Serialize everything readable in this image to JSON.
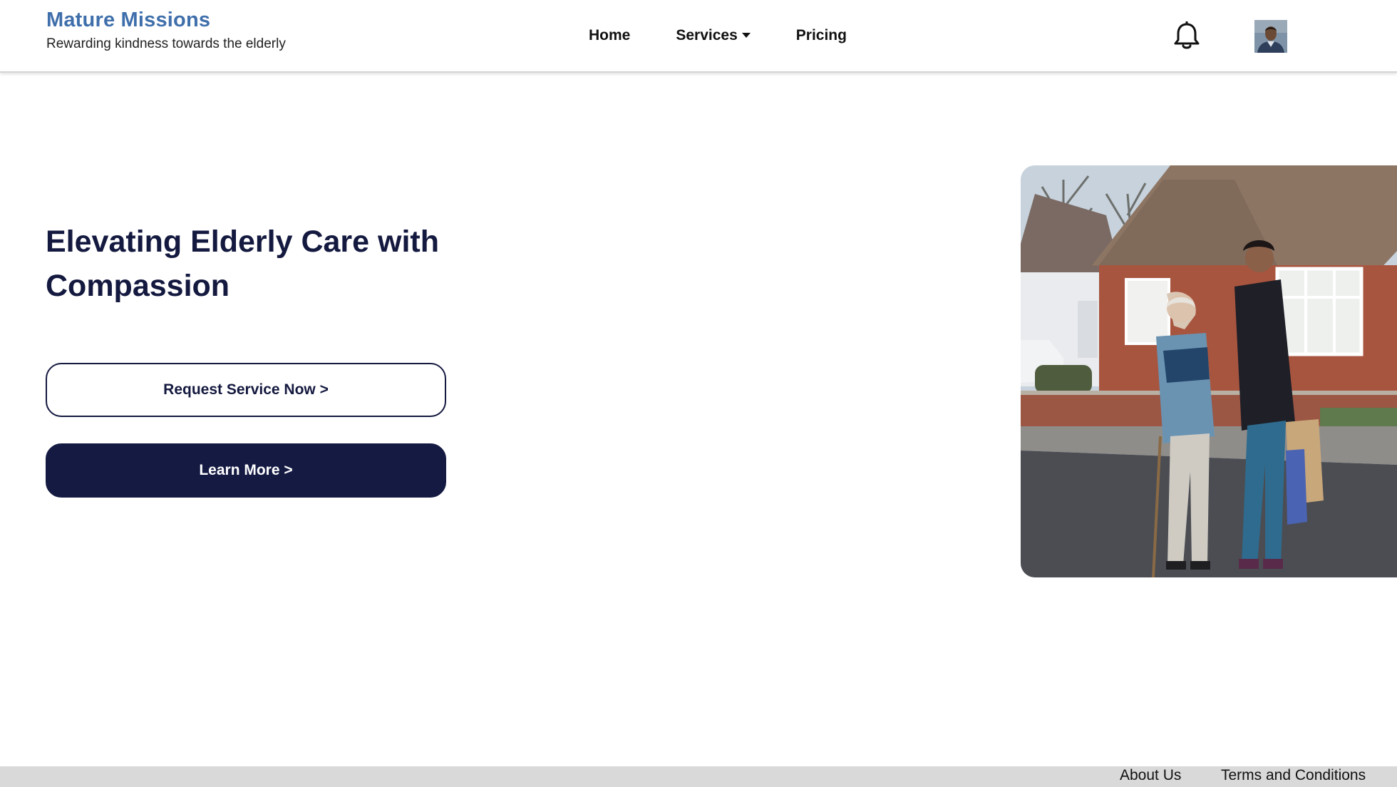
{
  "brand": {
    "title": "Mature Missions",
    "tagline": "Rewarding kindness towards the elderly",
    "color": "#3f6fab"
  },
  "nav": {
    "home": "Home",
    "services": "Services",
    "pricing": "Pricing"
  },
  "header_icons": {
    "notification": "bell-icon",
    "profile": "user-avatar"
  },
  "hero": {
    "title": "Elevating Elderly Care with Compassion",
    "primary_button": "Request Service Now >",
    "secondary_button": "Learn More >",
    "image_icon": "elderly-care-photo"
  },
  "footer": {
    "about": "About Us",
    "terms": "Terms and Conditions"
  },
  "colors": {
    "navy": "#14193f",
    "footer_bg": "#d9d9d9"
  }
}
